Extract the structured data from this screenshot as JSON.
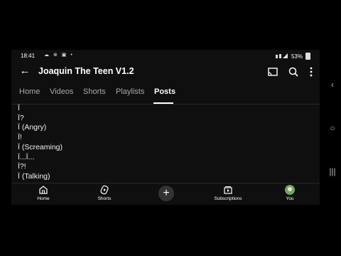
{
  "status": {
    "time": "18:41",
    "icons": "☁ ⊗ ▣ •",
    "battery": "53%"
  },
  "header": {
    "title": "Joaquin The Teen V1.2"
  },
  "tabs": [
    {
      "label": "Home",
      "active": false
    },
    {
      "label": "Videos",
      "active": false
    },
    {
      "label": "Shorts",
      "active": false
    },
    {
      "label": "Playlists",
      "active": false
    },
    {
      "label": "Posts",
      "active": true
    }
  ],
  "post": {
    "lines": [
      "Ï",
      "Ï?",
      "Ï (Angry)",
      "Ï!",
      "Ï (Screaming)",
      "Ï...Ï...",
      "Ï?!",
      "Ï (Talking)"
    ]
  },
  "bottom_nav": {
    "home": "Home",
    "shorts": "Shorts",
    "create": "+",
    "subscriptions": "Subscriptions",
    "you": "You"
  }
}
